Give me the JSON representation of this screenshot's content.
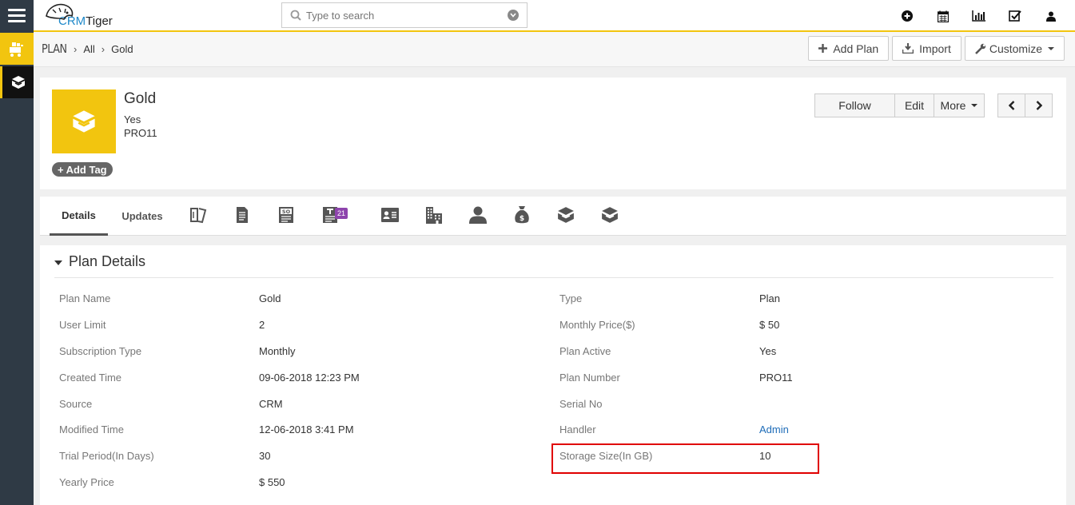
{
  "app": {
    "logo_text_a": "CRM",
    "logo_text_b": "Tiger"
  },
  "search": {
    "placeholder": "Type to search"
  },
  "breadcrumb": {
    "module": "PLAN",
    "level1": "All",
    "level2": "Gold"
  },
  "header_actions": {
    "add": "Add Plan",
    "import": "Import",
    "customize": "Customize"
  },
  "record": {
    "title": "Gold",
    "sub1": "Yes",
    "sub2": "PRO11",
    "add_tag": "Add Tag",
    "follow": "Follow",
    "edit": "Edit",
    "more": "More"
  },
  "tabs": {
    "details": "Details",
    "updates": "Updates",
    "badge_count": "21"
  },
  "section": {
    "title": "Plan Details"
  },
  "fields_left": [
    {
      "label": "Plan Name",
      "value": "Gold"
    },
    {
      "label": "User Limit",
      "value": "2"
    },
    {
      "label": "Subscription Type",
      "value": "Monthly"
    },
    {
      "label": "Created Time",
      "value": "09-06-2018 12:23 PM"
    },
    {
      "label": "Source",
      "value": "CRM"
    },
    {
      "label": "Modified Time",
      "value": "12-06-2018 3:41 PM"
    },
    {
      "label": "Trial Period(In Days)",
      "value": "30"
    },
    {
      "label": "Yearly Price",
      "value": "$ 550"
    }
  ],
  "fields_right": [
    {
      "label": "Type",
      "value": "Plan"
    },
    {
      "label": "Monthly Price($)",
      "value": "$ 50"
    },
    {
      "label": "Plan Active",
      "value": "Yes"
    },
    {
      "label": "Plan Number",
      "value": "PRO11"
    },
    {
      "label": "Serial No",
      "value": ""
    },
    {
      "label": "Handler",
      "value": "Admin"
    },
    {
      "label": "Storage Size(In GB)",
      "value": "10"
    }
  ],
  "colors": {
    "accent": "#f2c50f",
    "rail": "#2f3a45",
    "highlight": "#e00000",
    "link": "#1e6cb8"
  }
}
